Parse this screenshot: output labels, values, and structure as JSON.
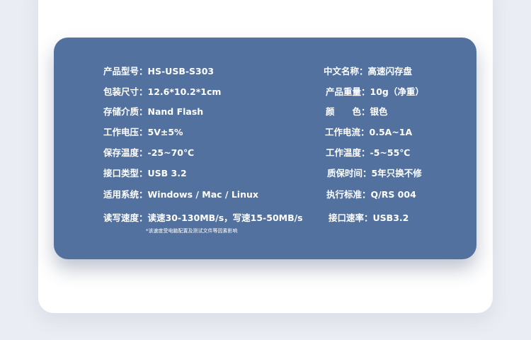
{
  "specs": {
    "left": [
      {
        "label": "产品型号：",
        "value": "HS-USB-S303"
      },
      {
        "label": "包装尺寸：",
        "value": "12.6*10.2*1cm"
      },
      {
        "label": "存储介质：",
        "value": "Nand Flash"
      },
      {
        "label": "工作电压：",
        "value": "5V±5%"
      },
      {
        "label": "保存温度：",
        "value": "-25~70℃"
      },
      {
        "label": "接口类型：",
        "value": "USB 3.2"
      },
      {
        "label": "适用系统：",
        "value": "Windows / Mac / Linux"
      },
      {
        "label": "读写速度：",
        "value": "读速30-130MB/s，写速15-50MB/s"
      }
    ],
    "right": [
      {
        "label": "中文名称：",
        "value": "高速闪存盘"
      },
      {
        "label": "产品重量：",
        "value": "10g（净重）"
      },
      {
        "label": "颜　　色：",
        "value": "银色"
      },
      {
        "label": "工作电流：",
        "value": "0.5A~1A"
      },
      {
        "label": "工作温度：",
        "value": "-5~55℃"
      },
      {
        "label": "质保时间：",
        "value": "5年只换不修"
      },
      {
        "label": "执行标准：",
        "value": "Q/RS 004"
      },
      {
        "label": "接口速率：",
        "value": "USB3.2"
      }
    ]
  },
  "footnote": "*该速度受电脑配置及测试文件等因素影响",
  "colors": {
    "panel": "#52719e",
    "text": "#ffffff",
    "background": "#ebedf4"
  }
}
